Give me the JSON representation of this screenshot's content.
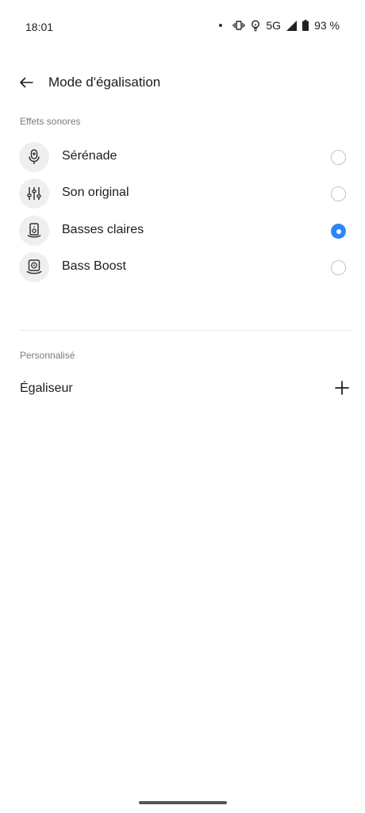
{
  "status_bar": {
    "time": "18:01",
    "network": "5G",
    "battery": "93 %",
    "icons": [
      "notification-dot-icon",
      "vibrate-icon",
      "bulb-icon",
      "signal-icon",
      "battery-icon"
    ]
  },
  "header": {
    "title": "Mode d'égalisation",
    "back_icon": "arrow-left-icon"
  },
  "sound_effects": {
    "section_label": "Effets sonores",
    "options": [
      {
        "label": "Sérénade",
        "icon": "microphone-icon",
        "selected": false
      },
      {
        "label": "Son original",
        "icon": "sliders-icon",
        "selected": false
      },
      {
        "label": "Basses claires",
        "icon": "speaker-icon",
        "selected": true
      },
      {
        "label": "Bass Boost",
        "icon": "subwoofer-icon",
        "selected": false
      }
    ]
  },
  "custom": {
    "section_label": "Personnalisé",
    "equalizer_label": "Égaliseur",
    "add_icon": "plus-icon"
  },
  "colors": {
    "accent": "#2f86f6",
    "icon_background": "#efefef",
    "secondary_text": "#7a7a7a"
  }
}
